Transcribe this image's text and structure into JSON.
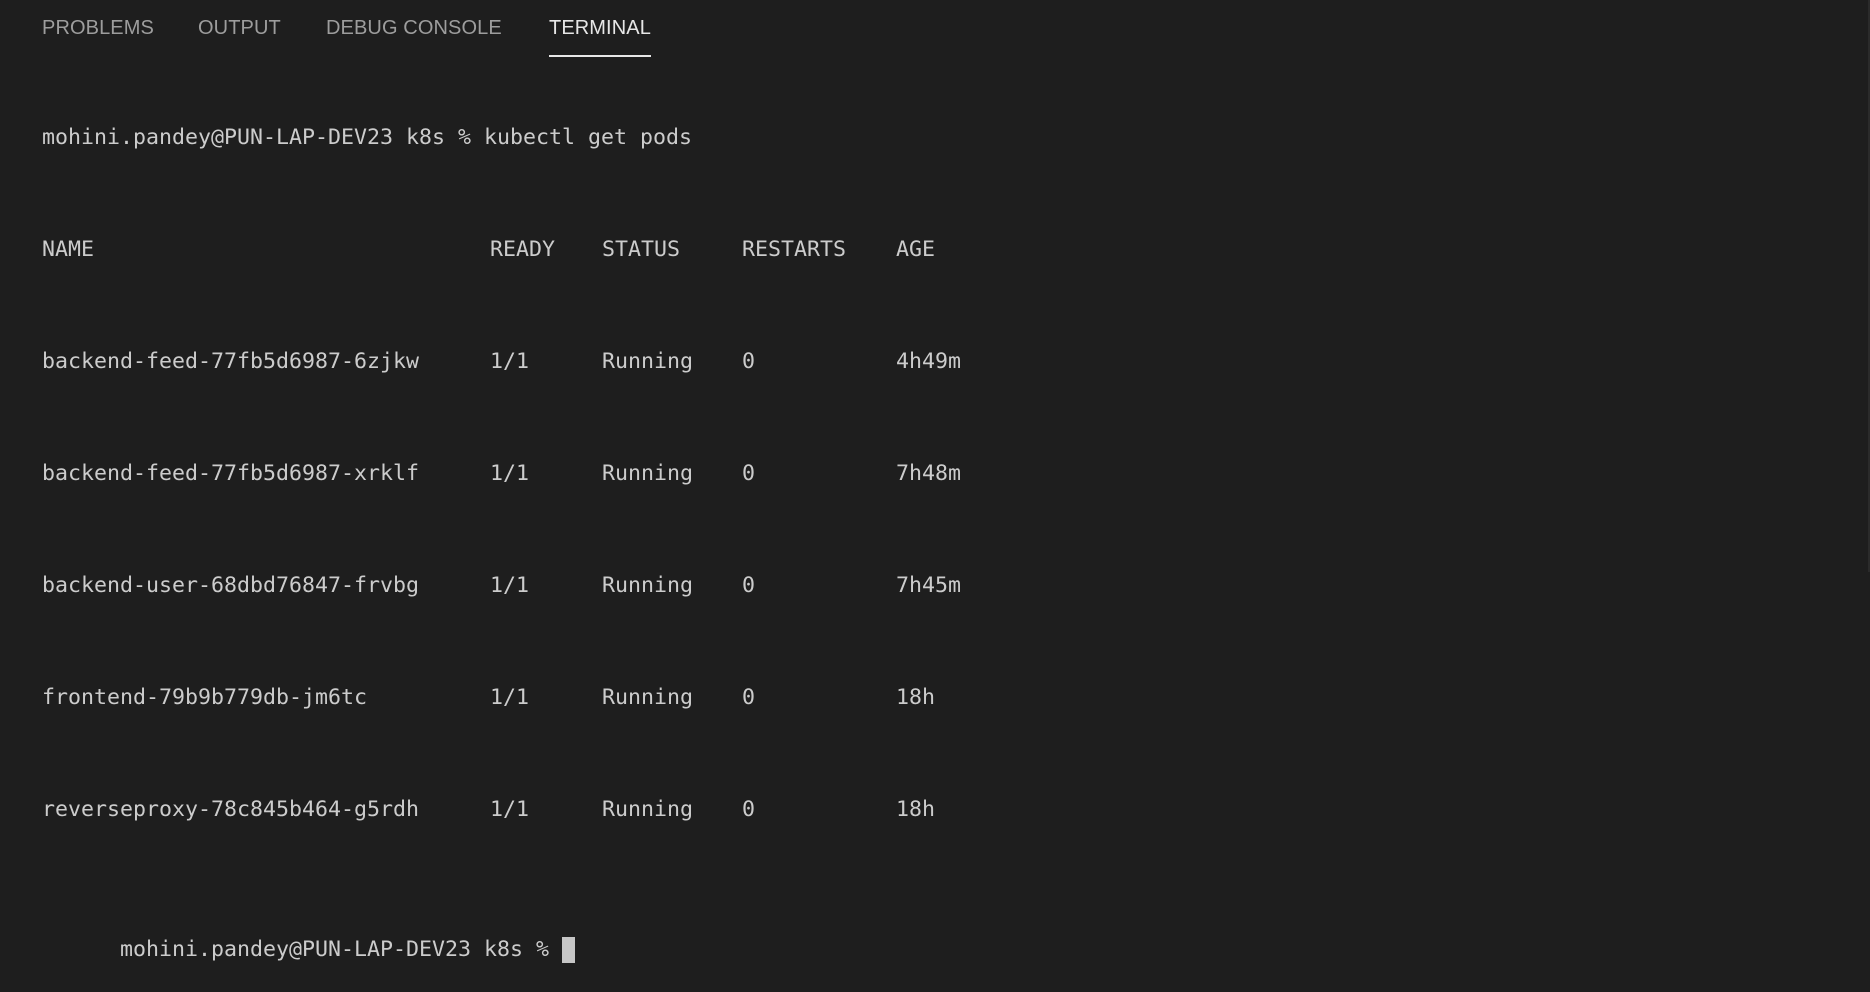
{
  "tabs": [
    {
      "label": "PROBLEMS",
      "active": false
    },
    {
      "label": "OUTPUT",
      "active": false
    },
    {
      "label": "DEBUG CONSOLE",
      "active": false
    },
    {
      "label": "TERMINAL",
      "active": true
    }
  ],
  "terminal": {
    "command_line": "mohini.pandey@PUN-LAP-DEV23 k8s % kubectl get pods",
    "headers": {
      "name": "NAME",
      "ready": "READY",
      "status": "STATUS",
      "restarts": "RESTARTS",
      "age": "AGE"
    },
    "rows": [
      {
        "name": "backend-feed-77fb5d6987-6zjkw",
        "ready": "1/1",
        "status": "Running",
        "restarts": "0",
        "age": "4h49m"
      },
      {
        "name": "backend-feed-77fb5d6987-xrklf",
        "ready": "1/1",
        "status": "Running",
        "restarts": "0",
        "age": "7h48m"
      },
      {
        "name": "backend-user-68dbd76847-frvbg",
        "ready": "1/1",
        "status": "Running",
        "restarts": "0",
        "age": "7h45m"
      },
      {
        "name": "frontend-79b9b779db-jm6tc",
        "ready": "1/1",
        "status": "Running",
        "restarts": "0",
        "age": "18h"
      },
      {
        "name": "reverseproxy-78c845b464-g5rdh",
        "ready": "1/1",
        "status": "Running",
        "restarts": "0",
        "age": "18h"
      }
    ],
    "prompt": "mohini.pandey@PUN-LAP-DEV23 k8s % "
  },
  "colors": {
    "background": "#1e1e1e",
    "text": "#cccccc",
    "tab_inactive": "#9d9d9d",
    "tab_active": "#e7e7e7",
    "cursor": "#c6c6c6"
  }
}
